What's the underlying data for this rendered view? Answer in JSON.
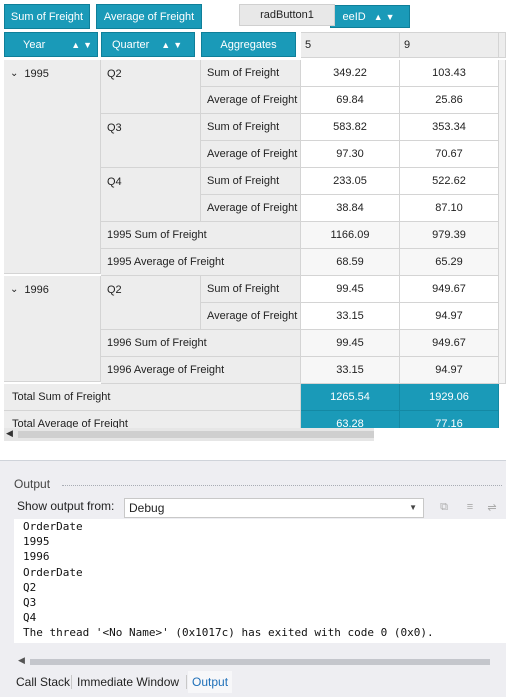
{
  "toolbar": {
    "chip_sum": "Sum of Freight",
    "chip_avg": "Average of Freight",
    "radbutton": "radButton1",
    "chip_emp": "eeID"
  },
  "grid": {
    "headers": {
      "year": "Year",
      "quarter": "Quarter",
      "aggregates": "Aggregates"
    },
    "columns": [
      "5",
      "9"
    ],
    "rows": {
      "y1995": "1995",
      "y1996": "1996",
      "q2": "Q2",
      "q3": "Q3",
      "q4": "Q4",
      "q2b": "Q2",
      "sum": "Sum of Freight",
      "avg": "Average of Freight"
    },
    "values": {
      "r1": [
        "349.22",
        "103.43"
      ],
      "r2": [
        "69.84",
        "25.86"
      ],
      "r3": [
        "583.82",
        "353.34"
      ],
      "r4": [
        "97.30",
        "70.67"
      ],
      "r5": [
        "233.05",
        "522.62"
      ],
      "r6": [
        "38.84",
        "87.10"
      ],
      "r7": [
        "1166.09",
        "979.39"
      ],
      "r8": [
        "68.59",
        "65.29"
      ],
      "r9": [
        "99.45",
        "949.67"
      ],
      "r10": [
        "33.15",
        "94.97"
      ],
      "r11": [
        "99.45",
        "949.67"
      ],
      "r12": [
        "33.15",
        "94.97"
      ],
      "r13": [
        "1265.54",
        "1929.06"
      ],
      "r14": [
        "63.28",
        "77.16"
      ]
    },
    "subtotals": {
      "s1995_sum": "1995 Sum of Freight",
      "s1995_avg": "1995 Average of Freight",
      "s1996_sum": "1996 Sum of Freight",
      "s1996_avg": "1996 Average of Freight",
      "total_sum": "Total Sum of Freight",
      "total_avg": "Total Average of Freight"
    }
  },
  "output": {
    "title": "Output",
    "show_label": "Show output from:",
    "source": "Debug",
    "lines": [
      "OrderDate",
      "1995",
      "1996",
      "OrderDate",
      "Q2",
      "Q3",
      "Q4",
      "The thread '<No Name>' (0x1017c) has exited with code 0 (0x0)."
    ]
  },
  "tabs": [
    "Call Stack",
    "Immediate Window",
    "Output"
  ],
  "colors": {
    "accent": "#1a9ab8",
    "header_bg": "#ededed",
    "active_tab": "#1e6fb8"
  }
}
